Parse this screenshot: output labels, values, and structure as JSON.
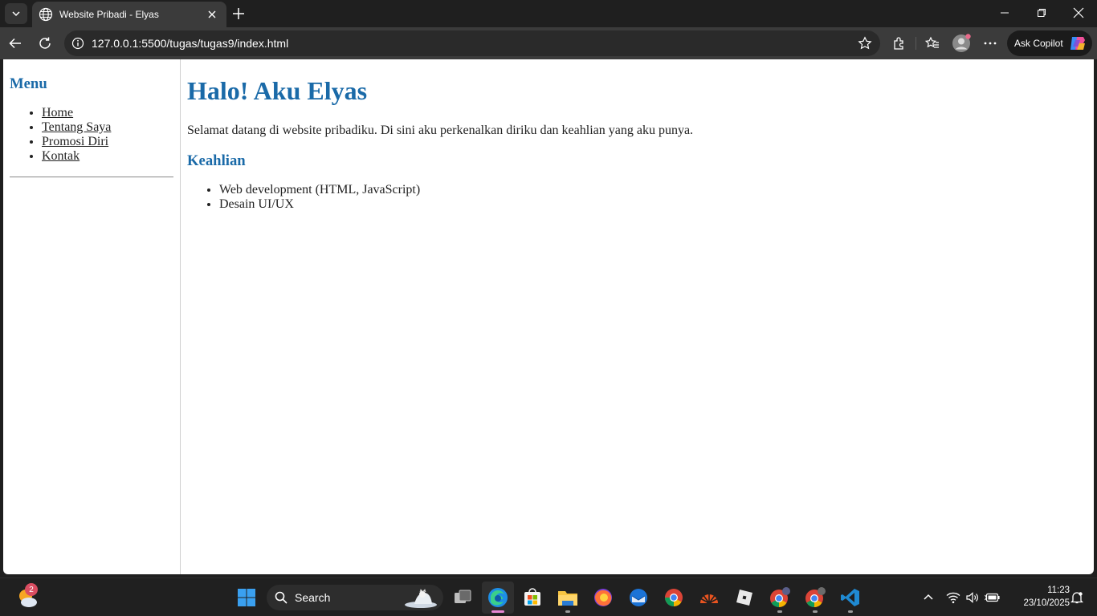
{
  "browser": {
    "tab_title": "Website Pribadi - Elyas",
    "url": "127.0.0.1:5500/tugas/tugas9/index.html",
    "copilot_label": "Ask Copilot"
  },
  "page": {
    "sidebar": {
      "heading": "Menu",
      "items": [
        {
          "label": "Home"
        },
        {
          "label": "Tentang Saya"
        },
        {
          "label": "Promosi Diri"
        },
        {
          "label": "Kontak"
        }
      ]
    },
    "main": {
      "title": "Halo! Aku Elyas",
      "intro": "Selamat datang di website pribadiku. Di sini aku perkenalkan diriku dan keahlian yang aku punya.",
      "skills_heading": "Keahlian",
      "skills": [
        {
          "label": "Web development (HTML, JavaScript)"
        },
        {
          "label": "Desain UI/UX"
        }
      ]
    }
  },
  "taskbar": {
    "weather_badge": "2",
    "search_label": "Search",
    "time": "11:23",
    "date": "23/10/2025"
  },
  "colors": {
    "heading_blue": "#1a6aa8",
    "browser_dark": "#1f1f1f",
    "toolbar": "#3b3b3b"
  },
  "icons": {
    "tab": "globe-icon",
    "nav": [
      "back-arrow-icon",
      "refresh-icon",
      "info-icon",
      "star-icon",
      "extensions-icon",
      "favorites-icon",
      "profile-icon",
      "more-icon",
      "copilot-icon"
    ],
    "taskbar": [
      "windows-start-icon",
      "search-icon",
      "task-view-icon",
      "edge-icon",
      "store-icon",
      "file-explorer-icon",
      "firefox-icon",
      "thunderbird-icon",
      "chrome-icon",
      "ubuntu-icon",
      "roblox-icon",
      "chrome-profile-icon",
      "chrome-profile-2-icon",
      "vscode-icon"
    ]
  }
}
